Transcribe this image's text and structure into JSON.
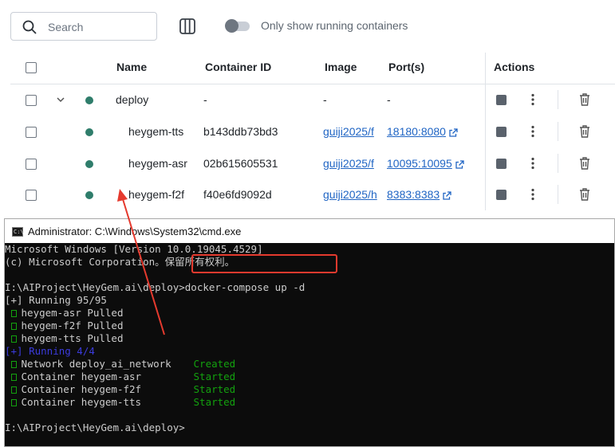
{
  "search": {
    "placeholder": "Search"
  },
  "toolbar": {
    "columns_icon": "columns-icon",
    "toggle_label": "Only show running containers"
  },
  "table": {
    "headers": {
      "name": "Name",
      "container_id": "Container ID",
      "image": "Image",
      "ports": "Port(s)",
      "actions": "Actions"
    },
    "group": {
      "name": "deploy",
      "container_id": "-",
      "image": "-",
      "ports": "-"
    },
    "rows": [
      {
        "name": "heygem-tts",
        "container_id": "b143ddb73bd3",
        "image": "guiji2025/f",
        "ports": "18180:8080"
      },
      {
        "name": "heygem-asr",
        "container_id": "02b615605531",
        "image": "guiji2025/f",
        "ports": "10095:10095"
      },
      {
        "name": "heygem-f2f",
        "container_id": "f40e6fd9092d",
        "image": "guiji2025/h",
        "ports": "8383:8383"
      }
    ]
  },
  "colors": {
    "running_dot": "#2f7d6b",
    "link": "#2065c4",
    "terminal_bg": "#0c0c0c",
    "terminal_green": "#13a10e",
    "highlight_red": "#e53a2e"
  },
  "cmd": {
    "icon_text": "C:\\",
    "title": "Administrator: C:\\Windows\\System32\\cmd.exe",
    "lines": {
      "l1": "Microsoft Windows [Version 10.0.19045.4529]",
      "l2": "(c) Microsoft Corporation。保留所有权利。",
      "prompt1": "I:\\AIProject\\HeyGem.ai\\deploy>",
      "command": "docker-compose up -d",
      "running1": "[+] Running 95/95",
      "pull1": "heygem-asr Pulled",
      "pull2": "heygem-f2f Pulled",
      "pull3": "heygem-tts Pulled",
      "running2": "[+] Running 4/4",
      "net": "Network deploy_ai_network",
      "net_status": "Created",
      "c1": "Container heygem-asr",
      "c1_status": "Started",
      "c2": "Container heygem-f2f",
      "c2_status": "Started",
      "c3": "Container heygem-tts",
      "c3_status": "Started",
      "prompt2": "I:\\AIProject\\HeyGem.ai\\deploy>"
    }
  }
}
